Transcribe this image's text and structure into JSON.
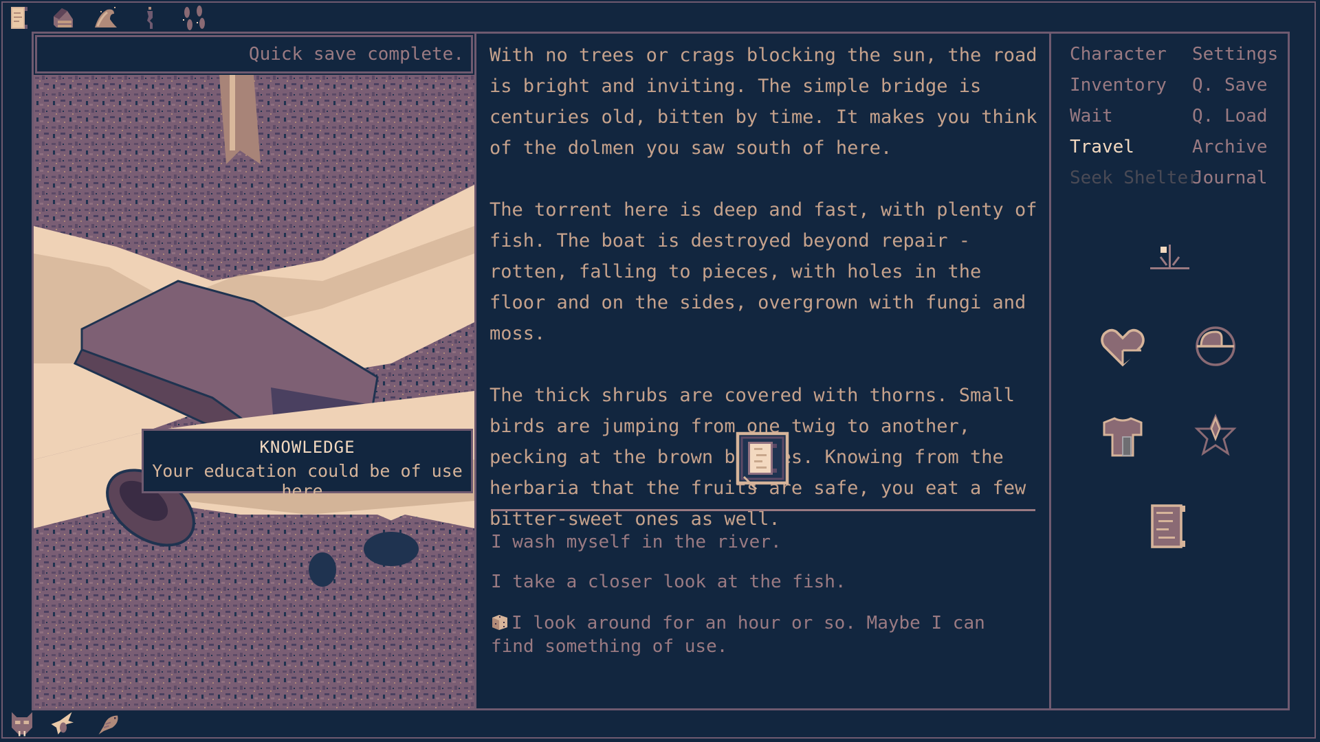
{
  "top_icons": [
    "scroll-icon",
    "house-icon",
    "wave-icon",
    "figure-icon",
    "footprints-icon"
  ],
  "bottom_icons": [
    "wolf-icon",
    "bird-icon",
    "fish-icon"
  ],
  "status": {
    "quick_save": "Quick save complete."
  },
  "tooltip": {
    "title": "KNOWLEDGE",
    "text": "Your education could be of use here."
  },
  "narrative": {
    "paragraphs": [
      "With no trees or crags blocking the sun, the road is bright and inviting. The simple bridge is centuries old, bitten by time. It makes you think of the dolmen you saw south of here.",
      "The torrent here is deep and fast, with plenty of fish. The boat is destroyed beyond repair - rotten, falling to pieces, with holes in the floor and on the sides, overgrown with fungi and moss.",
      "The thick shrubs are covered with thorns. Small birds are jumping from one twig to another, pecking at the brown berries. Knowing from the herbaria that the fruits are safe, you eat a few bitter-sweet ones as well."
    ],
    "knowledge_button_icon": "scroll-icon"
  },
  "choices": [
    {
      "text": "I wash myself in the river.",
      "icon": null
    },
    {
      "text": "I take a closer look at the fish.",
      "icon": null
    },
    {
      "text": "I look around for an hour or so. Maybe I can find something of use.",
      "icon": "dice-icon"
    }
  ],
  "menu": {
    "left": [
      {
        "label": "Character",
        "state": "normal"
      },
      {
        "label": "Inventory",
        "state": "normal"
      },
      {
        "label": "Wait",
        "state": "normal"
      },
      {
        "label": "Travel",
        "state": "active"
      },
      {
        "label": "Seek Shelter",
        "state": "disabled"
      }
    ],
    "right": [
      {
        "label": "Settings",
        "state": "normal"
      },
      {
        "label": "Q. Save",
        "state": "normal"
      },
      {
        "label": "Q. Load",
        "state": "normal"
      },
      {
        "label": "Archive",
        "state": "normal"
      },
      {
        "label": "Journal",
        "state": "normal"
      }
    ]
  },
  "status_icons": {
    "time": "sundial-icon",
    "health": "heart-icon",
    "nourishment": "bowl-icon",
    "clothing": "shirt-icon",
    "morale": "star-icon",
    "notes": "scroll-icon"
  },
  "colors": {
    "background": "#12263f",
    "border": "#6f5a70",
    "text": "#c6a28c",
    "muted": "#9a7a82",
    "highlight": "#f3d9c0",
    "disabled": "#4a4a55"
  }
}
